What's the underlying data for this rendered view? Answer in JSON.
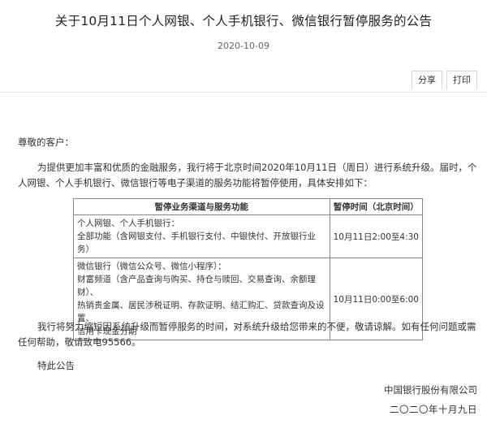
{
  "title": "关于10月11日个人网银、个人手机银行、微信银行暂停服务的公告",
  "date": "2020-10-09",
  "actions": {
    "share_label": "分享",
    "print_label": "打印"
  },
  "body": {
    "greeting": "尊敬的客户：",
    "intro": "为提供更加丰富和优质的金融服务，我行将于北京时间2020年10月11日（周日）进行系统升级。届时，个人网银、个人手机银行、微信银行等电子渠道的服务功能将暂停使用，具体安排如下：",
    "table": {
      "headers": [
        "暂停业务渠道与服务功能",
        "暂停时间（北京时间）"
      ],
      "rows": [
        {
          "channel_lines": [
            "个人网银、个人手机银行：",
            "全部功能（含网银支付、手机银行支付、中银快付、开放银行业务）"
          ],
          "time": "10月11日2:00至4:30"
        },
        {
          "channel_lines": [
            "微信银行（微信公众号、微信小程序）：",
            "财富频道（含产品查询与购买、持仓与赎回、交易查询、余额理财）、",
            "热销贵金属、居民涉税证明、存款证明、结汇购汇、贷款查询及设置、",
            "信用卡现金分期"
          ],
          "time": "10月11日0:00至6:00"
        }
      ]
    },
    "apology": "我行将努力缩短因系统升级而暂停服务的时间，对系统升级给您带来的不便，敬请谅解。如有任何问题或需任何帮助，敬请致电95566。",
    "closing": "特此公告",
    "organization": "中国银行股份有限公司",
    "sign_date": "二〇二〇年十月九日"
  }
}
